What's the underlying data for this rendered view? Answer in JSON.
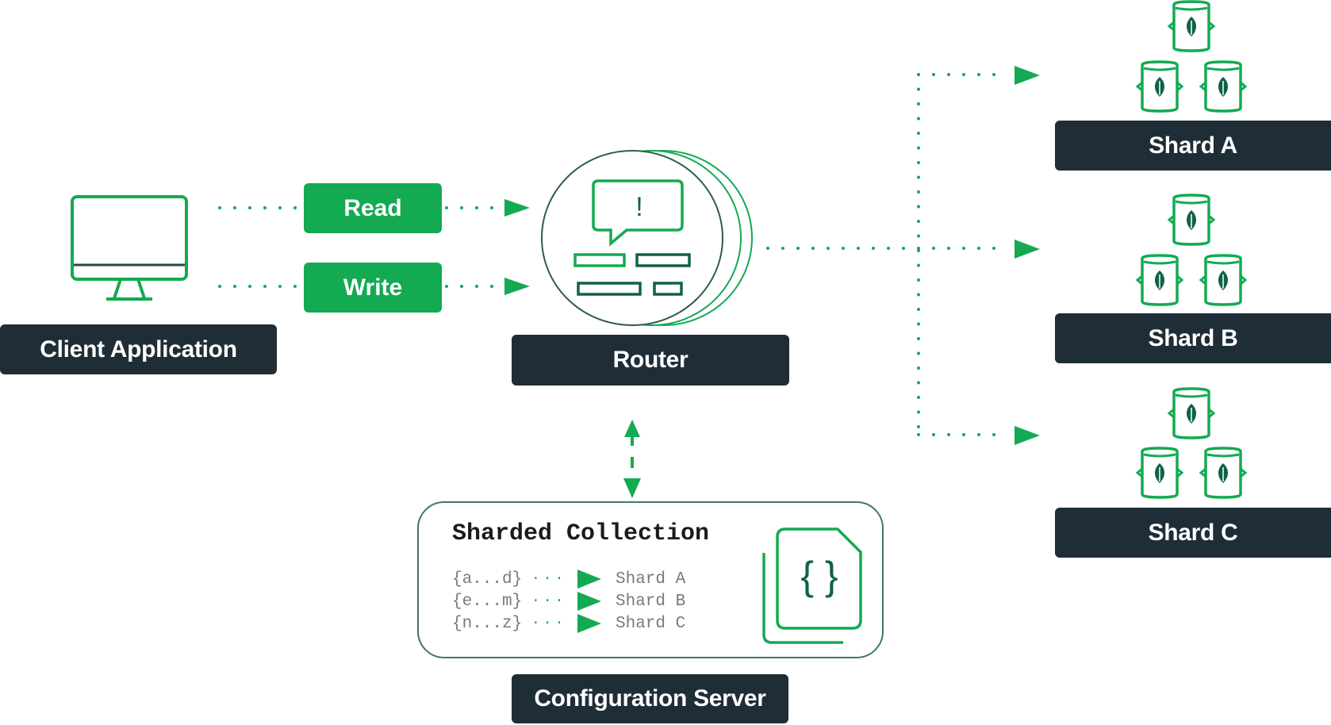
{
  "colors": {
    "green": "#13AA52",
    "dark_green": "#116149",
    "label_bg": "#1F2D36",
    "label_text": "#FFFFFF",
    "panel_border": "#3D7A5E"
  },
  "client": {
    "label": "Client Application",
    "icon": "monitor-icon"
  },
  "operations": {
    "read_label": "Read",
    "write_label": "Write"
  },
  "router": {
    "label": "Router",
    "icon": "router-stack-icon",
    "alert_glyph": "!"
  },
  "shards": [
    {
      "label": "Shard A",
      "icon": "mongodb-replica-set-icon"
    },
    {
      "label": "Shard B",
      "icon": "mongodb-replica-set-icon"
    },
    {
      "label": "Shard C",
      "icon": "mongodb-replica-set-icon"
    }
  ],
  "config_server": {
    "label": "Configuration Server",
    "collection_title": "Sharded Collection",
    "document_icon": "json-document-icon",
    "document_glyph": "{ }",
    "mappings": [
      {
        "range": "{a...d}",
        "shard": "Shard A"
      },
      {
        "range": "{e...m}",
        "shard": "Shard B"
      },
      {
        "range": "{n...z}",
        "shard": "Shard C"
      }
    ],
    "connector": "bidirectional-arrow"
  }
}
